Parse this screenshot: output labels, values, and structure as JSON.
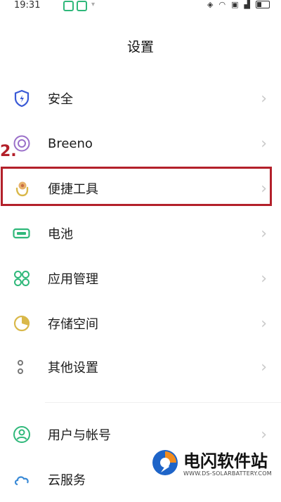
{
  "status_bar": {
    "time": "19:31"
  },
  "header": {
    "title": "设置"
  },
  "settings": {
    "items": [
      {
        "label": "安全",
        "icon": "shield-icon"
      },
      {
        "label": "Breeno",
        "icon": "breeno-icon"
      },
      {
        "label": "便捷工具",
        "icon": "hand-icon"
      },
      {
        "label": "电池",
        "icon": "battery-icon"
      },
      {
        "label": "应用管理",
        "icon": "apps-icon"
      },
      {
        "label": "存储空间",
        "icon": "storage-icon"
      },
      {
        "label": "其他设置",
        "icon": "other-settings-icon"
      },
      {
        "label": "用户与帐号",
        "icon": "user-icon"
      },
      {
        "label": "云服务",
        "icon": "cloud-icon"
      }
    ],
    "chevron": "›"
  },
  "annotation": {
    "step": "2."
  },
  "colors": {
    "accent_red": "#b3202a",
    "icon_green": "#2fb87a",
    "icon_blue": "#3a5ad6",
    "icon_purple": "#9a6fc9",
    "icon_yellow": "#d9b84a"
  },
  "watermark": {
    "title": "电闪软件站",
    "url": "WWW.DS-SOLARBATTERY.COM"
  }
}
